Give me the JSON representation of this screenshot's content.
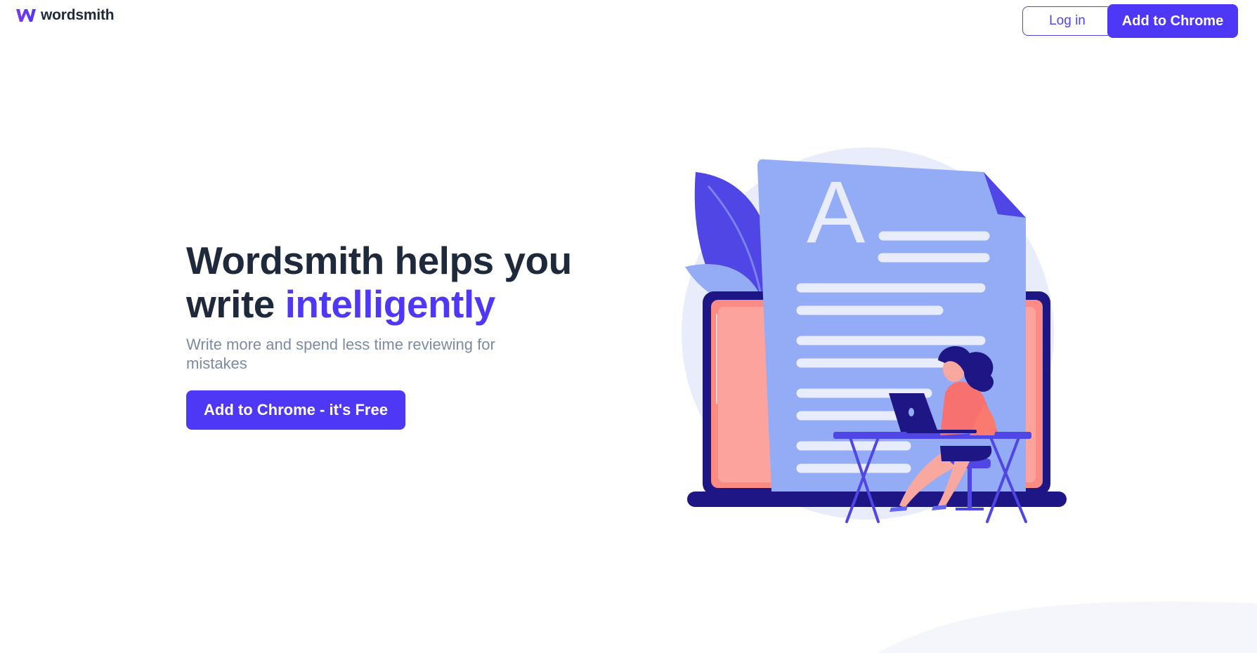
{
  "header": {
    "brand": "wordsmith",
    "logo_icon": "wordsmith-w-logo-icon",
    "login_label": "Log in",
    "add_to_chrome_label": "Add to Chrome"
  },
  "hero": {
    "title_part1": "Wordsmith helps you",
    "title_part2": "write ",
    "title_accent": "intelligently",
    "subtitle": "Write more and spend less time reviewing for mistakes",
    "cta_label": "Add to Chrome - it's Free"
  },
  "illustration": {
    "document_letter": "A",
    "icon": "woman-writing-at-desk-illustration"
  },
  "colors": {
    "accent": "#4f38f5",
    "heading": "#1e293b",
    "subtitle": "#7b8ba3",
    "document": "#93acf5",
    "laptop_dark": "#1e1685",
    "laptop_screen": "#fb8c85"
  }
}
